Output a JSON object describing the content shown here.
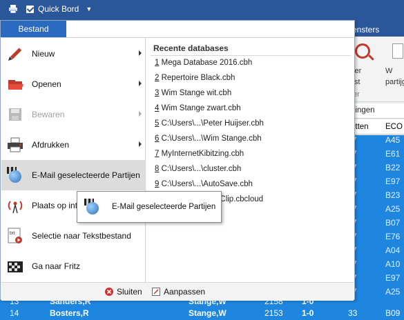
{
  "quickbar": {
    "label": "Quick Bord"
  },
  "ribbon": {
    "file_tab": "Bestand",
    "right_tab": "ensters",
    "btn1_line1": "lter",
    "btn1_line2": "ijst",
    "btn2_line1": "W",
    "btn2_line2": "partijg",
    "group": "ter",
    "subtab": "ningen",
    "col1": "etten",
    "col2": "ECO"
  },
  "menu": {
    "items": [
      {
        "label": "Nieuw",
        "icon": "pencil-icon",
        "submenu": true,
        "disabled": false
      },
      {
        "label": "Openen",
        "icon": "folder-open-icon",
        "submenu": true,
        "disabled": false
      },
      {
        "label": "Bewaren",
        "icon": "save-icon",
        "submenu": true,
        "disabled": true
      },
      {
        "label": "Afdrukken",
        "icon": "printer-icon",
        "submenu": true,
        "disabled": false
      },
      {
        "label": "E-Mail geselecteerde Partijen",
        "icon": "email-globe-icon",
        "submenu": false,
        "disabled": false
      },
      {
        "label": "Plaats op int",
        "icon": "broadcast-icon",
        "submenu": false,
        "disabled": false
      },
      {
        "label": "Selectie naar Tekstbestand",
        "icon": "text-file-icon",
        "submenu": false,
        "disabled": false
      },
      {
        "label": "Ga naar Fritz",
        "icon": "fritz-icon",
        "submenu": false,
        "disabled": false
      }
    ],
    "recent_header": "Recente databases",
    "recent": [
      {
        "num": "1",
        "name": "Mega Database 2016.cbh"
      },
      {
        "num": "2",
        "name": "Repertoire Black.cbh"
      },
      {
        "num": "3",
        "name": "Wim Stange wit.cbh"
      },
      {
        "num": "4",
        "name": "Wim Stange zwart.cbh"
      },
      {
        "num": "5",
        "name": "C:\\Users\\...\\Peter Huijser.cbh"
      },
      {
        "num": "6",
        "name": "C:\\Users\\...\\Wim Stange.cbh"
      },
      {
        "num": "7",
        "name": "MyInternetKibitzing.cbh"
      },
      {
        "num": "8",
        "name": "C:\\Users\\...\\cluster.cbh"
      },
      {
        "num": "9",
        "name": "C:\\Users\\...\\AutoSave.cbh"
      },
      {
        "num": "",
        "name": "dClip.cbcloud"
      }
    ],
    "footer": {
      "close": "Sluiten",
      "customize": "Aanpassen"
    }
  },
  "tooltip": {
    "label": "E-Mail geselecteerde Partijen"
  },
  "eco_codes": [
    "A45",
    "E61",
    "B22",
    "E97",
    "B23",
    "A25",
    "B07",
    "E76",
    "A04",
    "A10",
    "E97",
    "A25",
    "B09"
  ],
  "eco_prefix": [
    "7",
    "7",
    "7",
    "7",
    "7",
    "7",
    "7",
    "7",
    "7",
    "7",
    "7",
    "7",
    "33"
  ],
  "bottom_rows": [
    {
      "num": "13",
      "white": "Sanders,R",
      "black": "Stange,W",
      "elo": "2158",
      "result": "1-0"
    },
    {
      "num": "14",
      "white": "Bosters,R",
      "black": "Stange,W",
      "elo": "2153",
      "result": "1-0",
      "moves": "33",
      "eco": "B09"
    }
  ]
}
